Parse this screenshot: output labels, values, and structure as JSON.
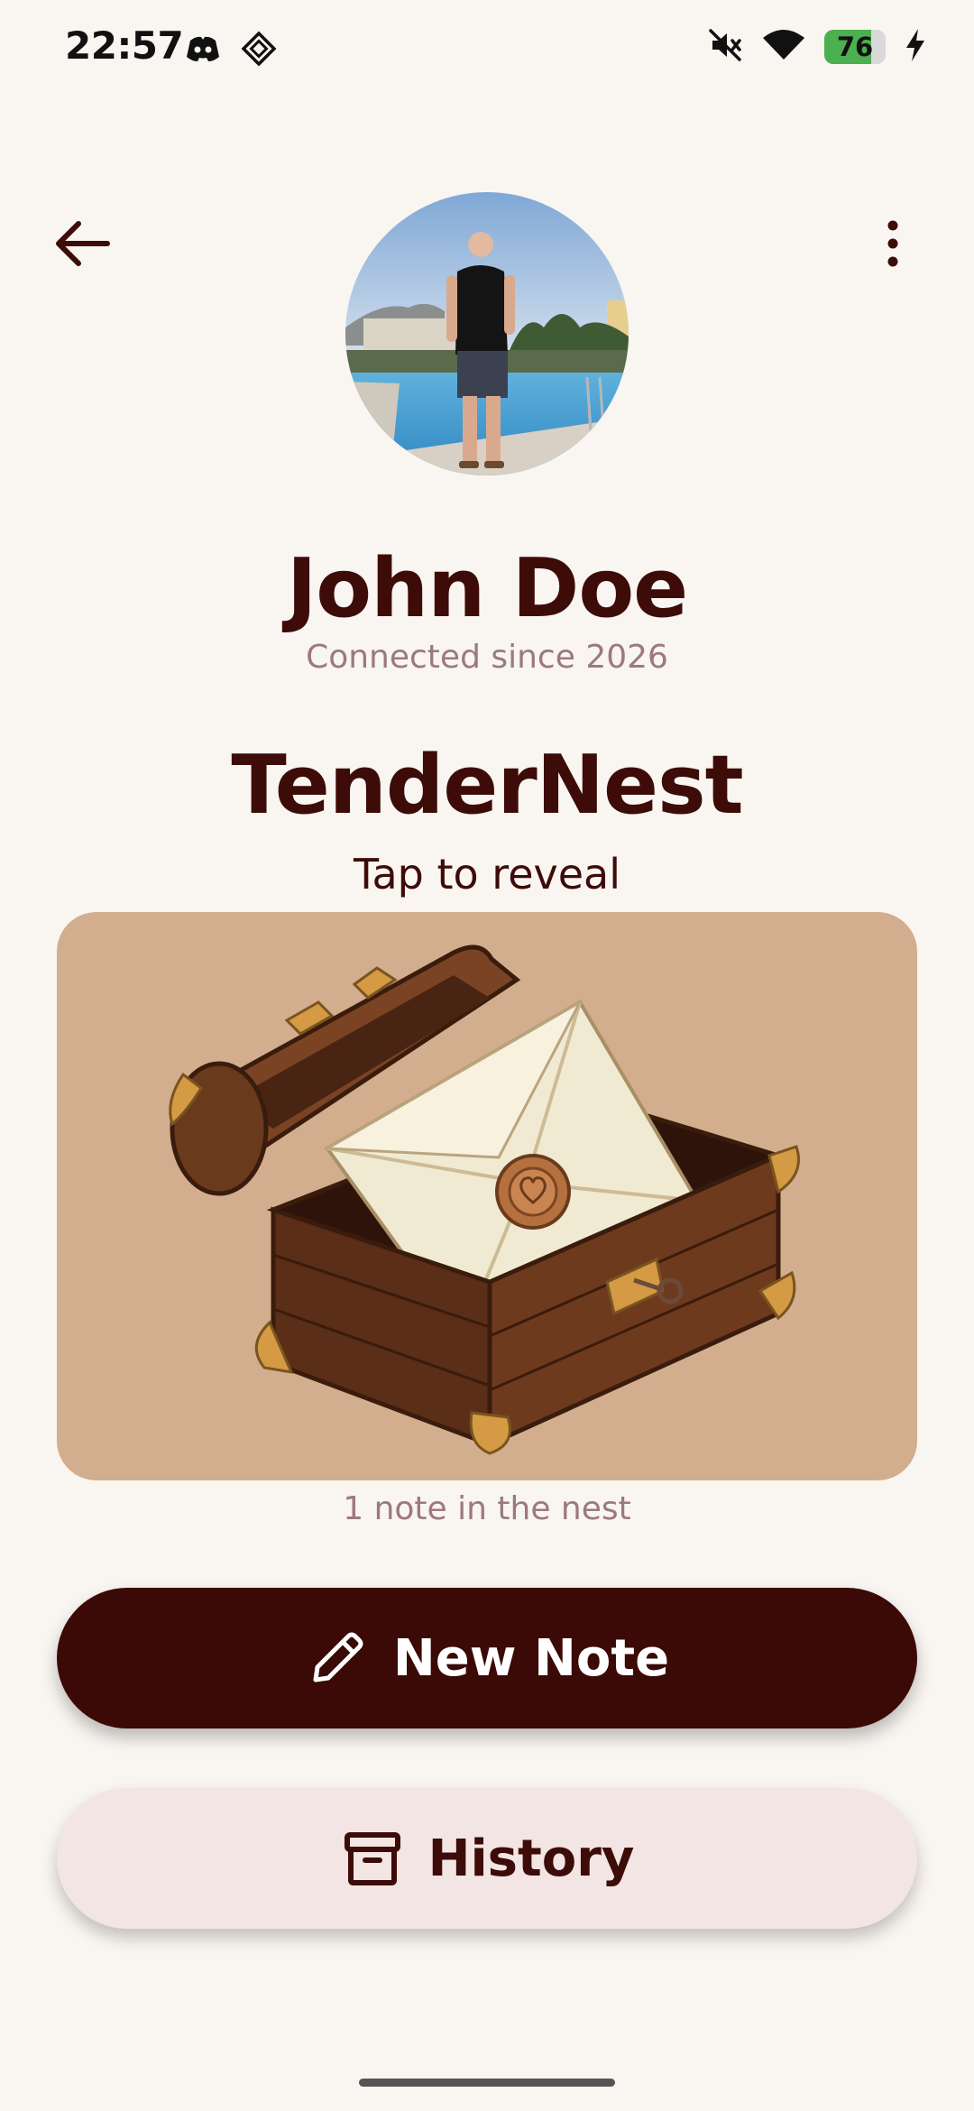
{
  "status_bar": {
    "time": "22:57",
    "left_icons": [
      "discord-icon",
      "app-diamond-icon"
    ],
    "right_icons": [
      "mute-icon",
      "wifi-icon",
      "battery-icon",
      "charging-icon"
    ],
    "battery_level": "76",
    "battery_fraction": 0.76
  },
  "top_bar": {
    "back_icon": "arrow-left-icon",
    "menu_icon": "more-vertical-icon"
  },
  "profile": {
    "name": "John Doe",
    "connected_since": "Connected since 2026"
  },
  "app": {
    "title": "TenderNest",
    "tap_hint": "Tap to reveal"
  },
  "nest": {
    "illustration": "treasure-chest-with-sealed-envelope",
    "note_count": "1 note in the nest"
  },
  "actions": {
    "new_note_label": "New Note",
    "new_note_icon": "pencil-icon",
    "history_label": "History",
    "history_icon": "archive-icon"
  },
  "colors": {
    "background": "#f9f5f1",
    "primary": "#3b0a06",
    "secondary_button": "#f2e5e3",
    "card": "#d2ae8e",
    "muted_text": "#9c7a7a"
  }
}
